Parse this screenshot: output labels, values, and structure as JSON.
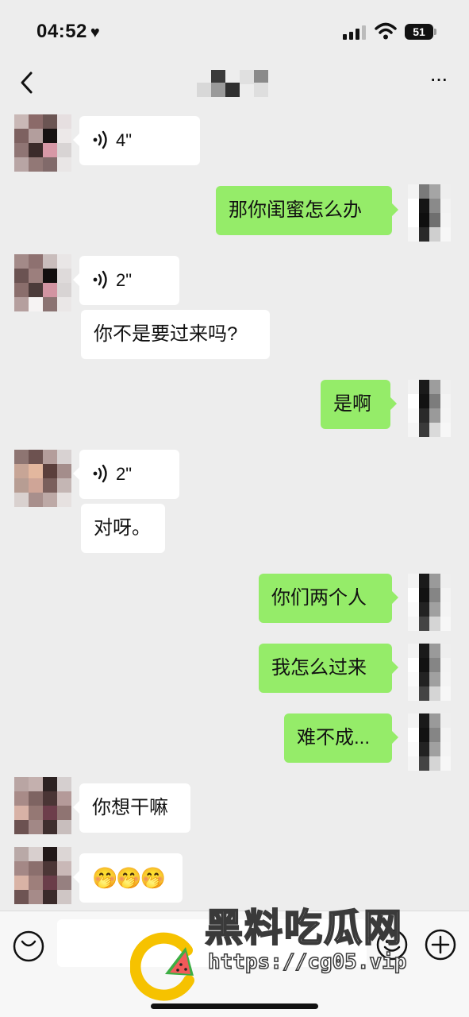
{
  "status_bar": {
    "time": "04:52",
    "heart": "♥",
    "battery": "51"
  },
  "nav": {
    "back_icon": "chevron-left-icon",
    "title": "",
    "more_icon": "more-dots-icon",
    "more_label": "···"
  },
  "messages": [
    {
      "side": "in",
      "type": "voice",
      "duration": "4\""
    },
    {
      "side": "out",
      "type": "text",
      "text": "那你闺蜜怎么办"
    },
    {
      "side": "in",
      "type": "voice",
      "duration": "2\""
    },
    {
      "side": "in",
      "type": "text",
      "text": "你不是要过来吗?"
    },
    {
      "side": "out",
      "type": "text",
      "text": "是啊"
    },
    {
      "side": "in",
      "type": "voice",
      "duration": "2\""
    },
    {
      "side": "in",
      "type": "text",
      "text": "对呀。"
    },
    {
      "side": "out",
      "type": "text",
      "text": "你们两个人"
    },
    {
      "side": "out",
      "type": "text",
      "text": "我怎么过来"
    },
    {
      "side": "out",
      "type": "text",
      "text": "难不成..."
    },
    {
      "side": "in",
      "type": "text",
      "text": "你想干嘛"
    },
    {
      "side": "in",
      "type": "emoji",
      "text": "🤭🤭🤭"
    }
  ],
  "input_bar": {
    "voice_icon": "voice-mode-icon",
    "emoji_icon": "emoji-icon",
    "plus_icon": "plus-icon",
    "placeholder": ""
  },
  "watermark": {
    "title": "黑料吃瓜网",
    "url": "https://cg05.vip"
  },
  "colors": {
    "background": "#ededed",
    "incoming_bubble": "#ffffff",
    "outgoing_bubble": "#95ec69"
  }
}
